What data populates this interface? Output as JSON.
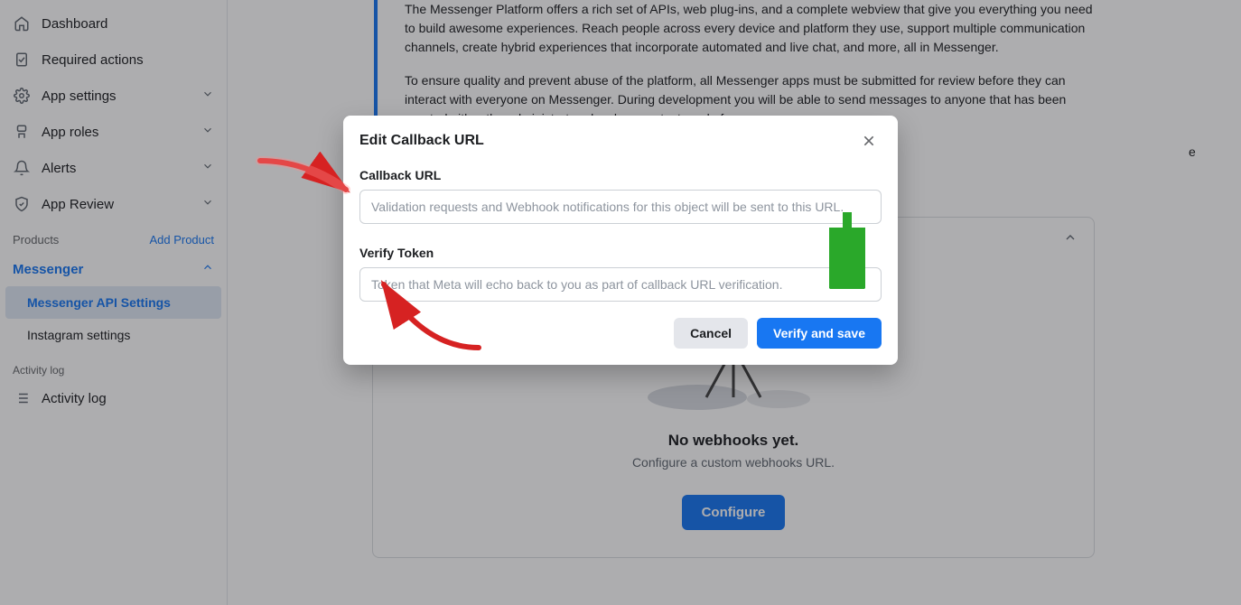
{
  "sidebar": {
    "items": [
      {
        "label": "Dashboard",
        "icon": "home"
      },
      {
        "label": "Required actions",
        "icon": "clipboard"
      },
      {
        "label": "App settings",
        "icon": "gear",
        "expandable": true
      },
      {
        "label": "App roles",
        "icon": "roles",
        "expandable": true
      },
      {
        "label": "Alerts",
        "icon": "bell",
        "expandable": true
      },
      {
        "label": "App Review",
        "icon": "shield",
        "expandable": true
      }
    ],
    "products_label": "Products",
    "add_product_label": "Add Product",
    "messenger": {
      "label": "Messenger",
      "items": [
        {
          "label": "Messenger API Settings",
          "active": true
        },
        {
          "label": "Instagram settings",
          "active": false
        }
      ]
    },
    "activity_section_label": "Activity log",
    "activity_item": "Activity log"
  },
  "main": {
    "paragraphs": [
      "The Messenger Platform offers a rich set of APIs, web plug-ins, and a complete webview that give you everything you need to build awesome experiences. Reach people across every device and platform they use, support multiple communication channels, create hybrid experiences that incorporate automated and live chat, and more, all in Messenger.",
      "To ensure quality and prevent abuse of the platform, all Messenger apps must be submitted for review before they can interact with everyone on Messenger. During development you will be able to send messages to anyone that has been granted either the administrator, developer or tester role for your app."
    ],
    "cutoff_fragment": "e of the platform are subject to",
    "card": {
      "title": "No webhooks yet.",
      "subtitle": "Configure a custom webhooks URL.",
      "configure_label": "Configure"
    }
  },
  "modal": {
    "title": "Edit Callback URL",
    "fields": {
      "callback": {
        "label": "Callback URL",
        "placeholder": "Validation requests and Webhook notifications for this object will be sent to this URL."
      },
      "verify_token": {
        "label": "Verify Token",
        "placeholder": "Token that Meta will echo back to you as part of callback URL verification."
      }
    },
    "cancel_label": "Cancel",
    "verify_label": "Verify and save"
  },
  "annotations": {
    "arrow1_color": "#d62222",
    "arrow2_color": "#d62222",
    "arrow3_color": "#2aa82a"
  }
}
